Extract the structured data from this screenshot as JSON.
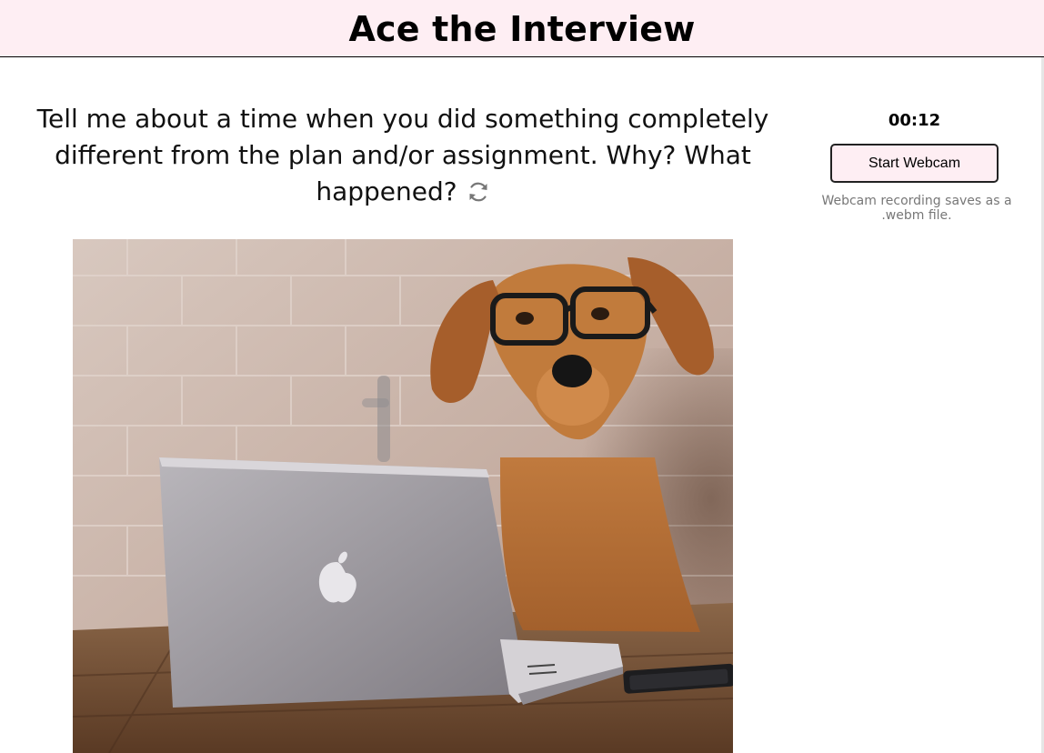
{
  "header": {
    "title": "Ace the Interview"
  },
  "question": {
    "text": "Tell me about a time when you did something completely different from the plan and/or assignment. Why? What happened?",
    "refresh_icon": "refresh-icon"
  },
  "image": {
    "subject": "dog-with-glasses-at-laptop",
    "colors": {
      "wall": "#c9b2a6",
      "table": "#6b4a33",
      "laptop": "#9d9aa0",
      "dog": "#b86f38"
    }
  },
  "recorder": {
    "timer": "00:12",
    "start_label": "Start Webcam",
    "hint": "Webcam recording saves as a .webm file."
  },
  "theme": {
    "header_bg": "#feeef3",
    "button_bg": "#feeef3"
  }
}
